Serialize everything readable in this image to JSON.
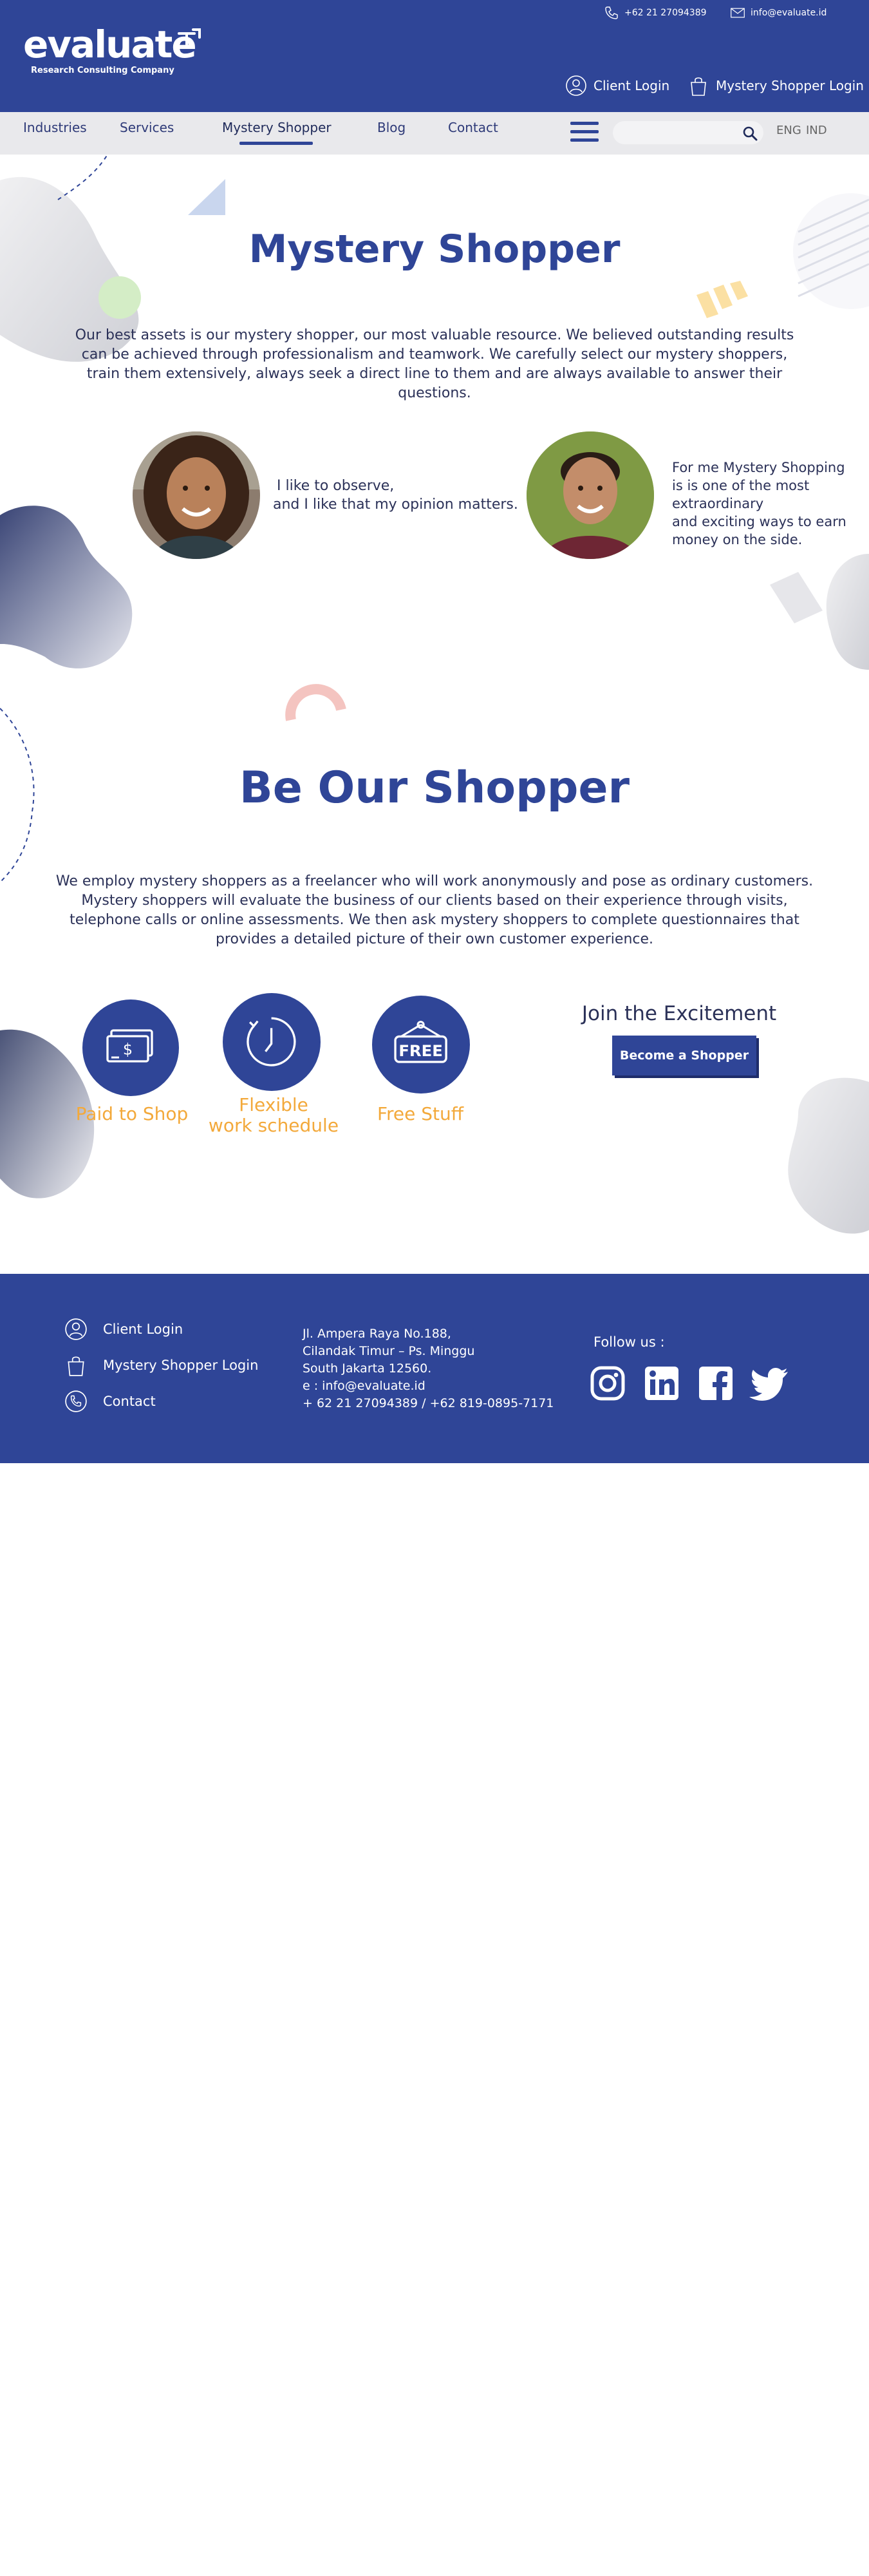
{
  "header": {
    "logo_text": "evaluate",
    "logo_tagline": "Research Consulting Company",
    "phone": "+62 21 27094389",
    "email": "info@evaluate.id",
    "client_login": "Client Login",
    "shopper_login": "Mystery Shopper Login"
  },
  "nav": {
    "items": [
      "Industries",
      "Services",
      "Mystery Shopper",
      "Blog",
      "Contact"
    ],
    "active": "Mystery Shopper",
    "search_placeholder": "",
    "lang_en": "ENG",
    "lang_id": "IND"
  },
  "intro": {
    "title": "Mystery Shopper",
    "body": "Our best assets is our mystery shopper, our most valuable resource. We believed outstanding results can be achieved through professionalism and teamwork. We carefully select our mystery shoppers, train them extensively, always seek a direct line to them and are always available to answer their questions."
  },
  "testimonials": [
    {
      "line1": "I like to observe,",
      "line2": "and I like that my opinion matters."
    },
    {
      "line1": "For me Mystery Shopping",
      "line2": "is is one of the most",
      "line3": "extraordinary",
      "line4": "and exciting ways to earn",
      "line5": "money on the side."
    }
  ],
  "be_shopper": {
    "title": "Be Our Shopper",
    "body": "We employ mystery shoppers as a freelancer who will work anonymously and pose as ordinary customers. Mystery shoppers will evaluate the business of our clients based on their experience through visits, telephone calls or online assessments. We then ask mystery shoppers to complete questionnaires that provides a detailed picture of their own customer experience."
  },
  "features": [
    {
      "label": "Paid to Shop",
      "icon": "money-icon"
    },
    {
      "label_line1": "Flexible",
      "label_line2": "work schedule",
      "icon": "clock-icon"
    },
    {
      "label": "Free Stuff",
      "icon": "free-sign-icon"
    }
  ],
  "join": {
    "title": "Join the Excitement",
    "button": "Become a Shopper"
  },
  "footer": {
    "links": [
      "Client Login",
      "Mystery Shopper Login",
      "Contact"
    ],
    "address": [
      "Jl. Ampera Raya No.188,",
      "Cilandak Timur – Ps. Minggu",
      "South Jakarta 12560."
    ],
    "email_line": "e : info@evaluate.id",
    "phone_line": "+ 62 21 27094389 / +62 819-0895-7171",
    "follow": "Follow us :",
    "social": [
      "instagram-icon",
      "linkedin-icon",
      "facebook-icon",
      "twitter-icon"
    ]
  },
  "colors": {
    "brand_blue": "#2f4597",
    "accent_orange": "#f3a93b",
    "nav_bg": "#e9e9ec",
    "text_dark": "#2b3158"
  }
}
